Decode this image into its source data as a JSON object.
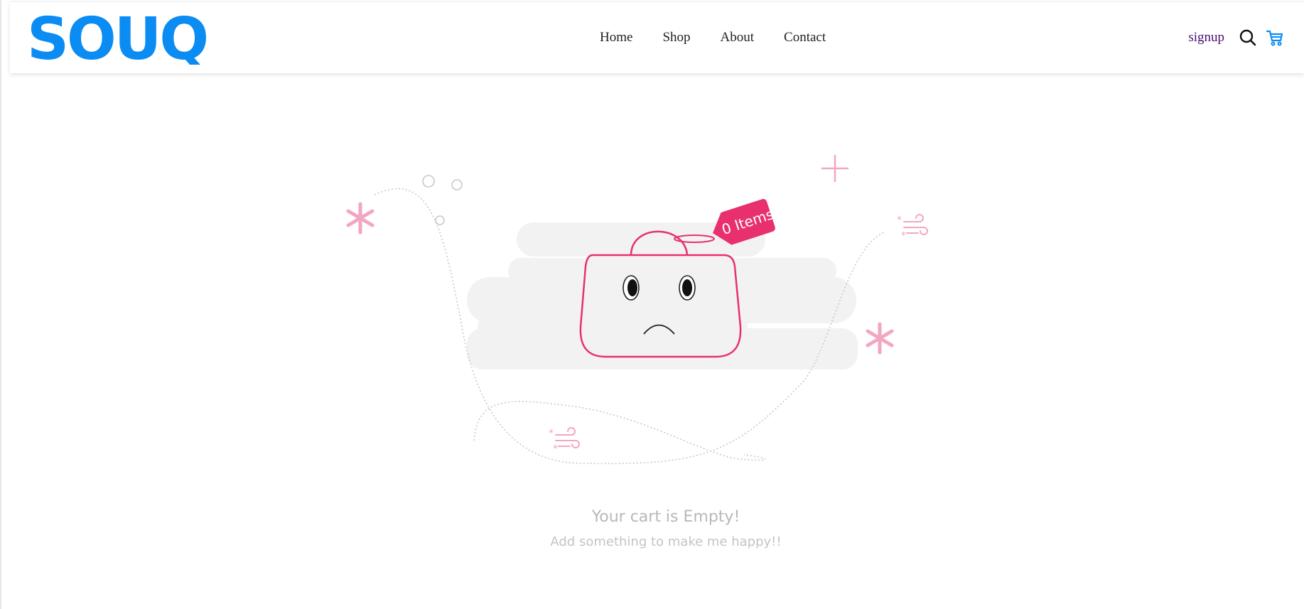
{
  "brand": {
    "logo_text": "SOUQ",
    "color": "#0b8cf2"
  },
  "nav": {
    "items": [
      {
        "label": "Home"
      },
      {
        "label": "Shop"
      },
      {
        "label": "About"
      },
      {
        "label": "Contact"
      }
    ]
  },
  "tools": {
    "signup_label": "signup",
    "search_icon": "search-icon",
    "cart_icon": "cart-icon"
  },
  "empty_cart": {
    "tag_text": "0 Items",
    "title": "Your cart is Empty!",
    "subtitle": "Add something to make me happy!!",
    "accent_color": "#e8306f",
    "decor_color": "#f3a6c3"
  }
}
